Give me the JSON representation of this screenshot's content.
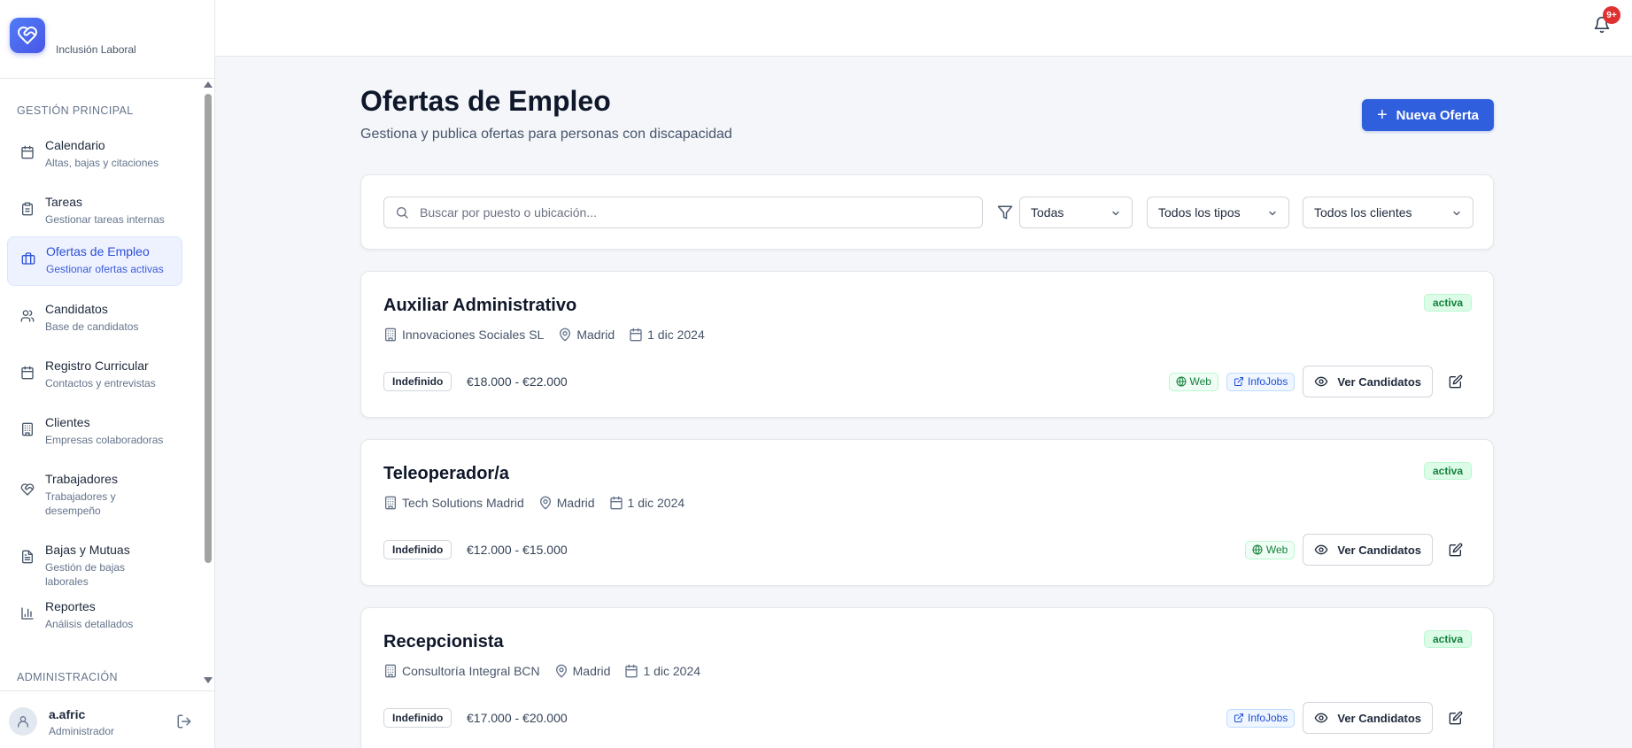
{
  "app": {
    "brand_name": "Inclusión Laboral"
  },
  "sidebar": {
    "section_main": "GESTIÓN PRINCIPAL",
    "section_admin": "ADMINISTRACIÓN",
    "items": [
      {
        "label": "Calendario",
        "sub": "Altas, bajas y citaciones",
        "icon": "calendar-icon"
      },
      {
        "label": "Tareas",
        "sub": "Gestionar tareas internas",
        "icon": "clipboard-icon"
      },
      {
        "label": "Ofertas de Empleo",
        "sub": "Gestionar ofertas activas",
        "icon": "briefcase-icon",
        "active": true
      },
      {
        "label": "Candidatos",
        "sub": "Base de candidatos",
        "icon": "users-icon"
      },
      {
        "label": "Registro Curricular",
        "sub": "Contactos y entrevistas",
        "icon": "calendar-icon"
      },
      {
        "label": "Clientes",
        "sub": "Empresas colaboradoras",
        "icon": "building-icon"
      },
      {
        "label": "Trabajadores",
        "sub": "Trabajadores y desempeño",
        "icon": "heart-handshake-icon"
      },
      {
        "label": "Bajas y Mutuas",
        "sub": "Gestión de bajas laborales",
        "icon": "file-text-icon"
      },
      {
        "label": "Reportes",
        "sub": "Análisis detallados",
        "icon": "bar-chart-icon"
      }
    ]
  },
  "user": {
    "name": "a.afric",
    "role": "Administrador"
  },
  "topbar": {
    "notification_count": "9+"
  },
  "main": {
    "title": "Ofertas de Empleo",
    "subtitle": "Gestiona y publica ofertas para personas con discapacidad",
    "new_button": "Nueva Oferta",
    "search_placeholder": "Buscar por puesto o ubicación...",
    "filters": {
      "status": "Todas",
      "type": "Todos los tipos",
      "client": "Todos los clientes"
    }
  },
  "jobs": [
    {
      "title": "Auxiliar Administrativo",
      "status": "activa",
      "company": "Innovaciones Sociales SL",
      "location": "Madrid",
      "date": "1 dic 2024",
      "contract": "Indefinido",
      "salary": "€18.000 - €22.000",
      "web_label": "Web",
      "infojobs_label": "InfoJobs",
      "view_label": "Ver Candidatos"
    },
    {
      "title": "Teleoperador/a",
      "status": "activa",
      "company": "Tech Solutions Madrid",
      "location": "Madrid",
      "date": "1 dic 2024",
      "contract": "Indefinido",
      "salary": "€12.000 - €15.000",
      "web_label": "Web",
      "view_label": "Ver Candidatos"
    },
    {
      "title": "Recepcionista",
      "status": "activa",
      "company": "Consultoría Integral BCN",
      "location": "Madrid",
      "date": "1 dic 2024",
      "contract": "Indefinido",
      "salary": "€17.000 - €20.000",
      "infojobs_label": "InfoJobs",
      "view_label": "Ver Candidatos"
    }
  ],
  "colors": {
    "primary": "#2f5fdd",
    "active_badge_bg": "#dcfce7",
    "notification_badge": "#e03131"
  }
}
